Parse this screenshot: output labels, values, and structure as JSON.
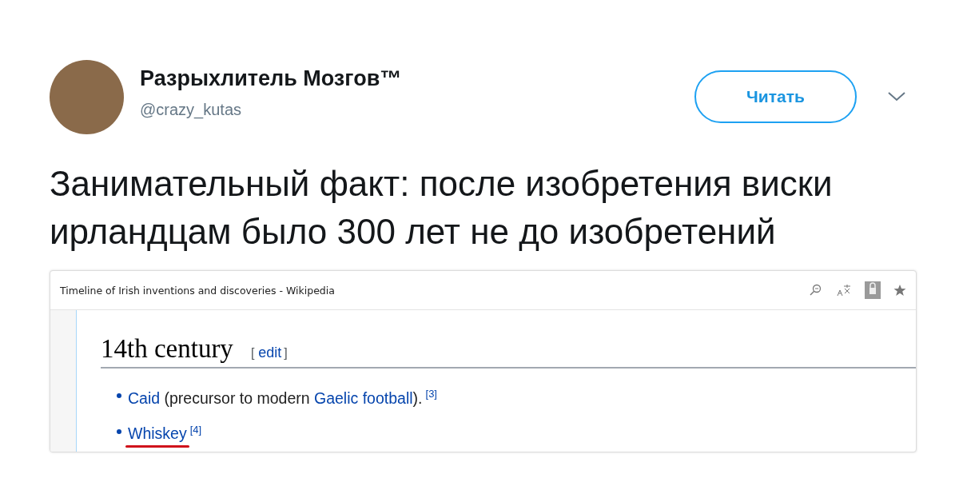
{
  "tweet": {
    "author": "Разрыхлитель Мозгов™",
    "handle": "@crazy_kutas",
    "follow_button": "Читать",
    "text": "Занимательный факт: после изобретения виски ирландцам было 300 лет не до изобретений"
  },
  "browser": {
    "title": "Timeline of Irish inventions and discoveries - Wikipedia",
    "heading": "14th century",
    "edit": {
      "open": "[",
      "label": "edit",
      "close": "]"
    },
    "items": [
      {
        "underlined": false,
        "parts": [
          {
            "kind": "link",
            "text": "Caid"
          },
          {
            "kind": "text",
            "text": " (precursor to modern "
          },
          {
            "kind": "link",
            "text": "Gaelic football"
          },
          {
            "kind": "text",
            "text": ")."
          },
          {
            "kind": "ref",
            "text": "[3]"
          }
        ]
      },
      {
        "underlined": true,
        "parts": [
          {
            "kind": "link",
            "text": "Whiskey"
          },
          {
            "kind": "ref",
            "text": "[4]"
          }
        ]
      }
    ]
  }
}
